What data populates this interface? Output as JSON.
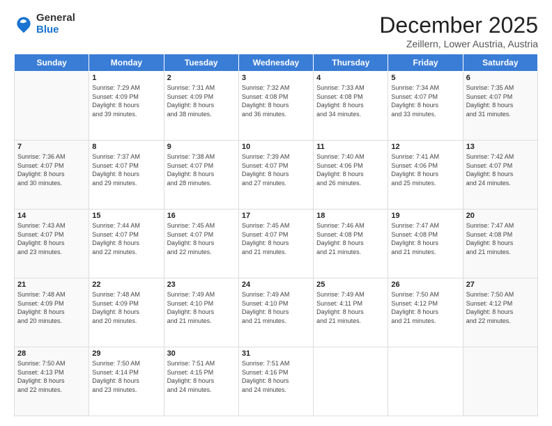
{
  "logo": {
    "general": "General",
    "blue": "Blue"
  },
  "header": {
    "month": "December 2025",
    "location": "Zeillern, Lower Austria, Austria"
  },
  "weekdays": [
    "Sunday",
    "Monday",
    "Tuesday",
    "Wednesday",
    "Thursday",
    "Friday",
    "Saturday"
  ],
  "weeks": [
    [
      {
        "day": "",
        "info": ""
      },
      {
        "day": "1",
        "info": "Sunrise: 7:29 AM\nSunset: 4:09 PM\nDaylight: 8 hours\nand 39 minutes."
      },
      {
        "day": "2",
        "info": "Sunrise: 7:31 AM\nSunset: 4:09 PM\nDaylight: 8 hours\nand 38 minutes."
      },
      {
        "day": "3",
        "info": "Sunrise: 7:32 AM\nSunset: 4:08 PM\nDaylight: 8 hours\nand 36 minutes."
      },
      {
        "day": "4",
        "info": "Sunrise: 7:33 AM\nSunset: 4:08 PM\nDaylight: 8 hours\nand 34 minutes."
      },
      {
        "day": "5",
        "info": "Sunrise: 7:34 AM\nSunset: 4:07 PM\nDaylight: 8 hours\nand 33 minutes."
      },
      {
        "day": "6",
        "info": "Sunrise: 7:35 AM\nSunset: 4:07 PM\nDaylight: 8 hours\nand 31 minutes."
      }
    ],
    [
      {
        "day": "7",
        "info": "Sunrise: 7:36 AM\nSunset: 4:07 PM\nDaylight: 8 hours\nand 30 minutes."
      },
      {
        "day": "8",
        "info": "Sunrise: 7:37 AM\nSunset: 4:07 PM\nDaylight: 8 hours\nand 29 minutes."
      },
      {
        "day": "9",
        "info": "Sunrise: 7:38 AM\nSunset: 4:07 PM\nDaylight: 8 hours\nand 28 minutes."
      },
      {
        "day": "10",
        "info": "Sunrise: 7:39 AM\nSunset: 4:07 PM\nDaylight: 8 hours\nand 27 minutes."
      },
      {
        "day": "11",
        "info": "Sunrise: 7:40 AM\nSunset: 4:06 PM\nDaylight: 8 hours\nand 26 minutes."
      },
      {
        "day": "12",
        "info": "Sunrise: 7:41 AM\nSunset: 4:06 PM\nDaylight: 8 hours\nand 25 minutes."
      },
      {
        "day": "13",
        "info": "Sunrise: 7:42 AM\nSunset: 4:07 PM\nDaylight: 8 hours\nand 24 minutes."
      }
    ],
    [
      {
        "day": "14",
        "info": "Sunrise: 7:43 AM\nSunset: 4:07 PM\nDaylight: 8 hours\nand 23 minutes."
      },
      {
        "day": "15",
        "info": "Sunrise: 7:44 AM\nSunset: 4:07 PM\nDaylight: 8 hours\nand 22 minutes."
      },
      {
        "day": "16",
        "info": "Sunrise: 7:45 AM\nSunset: 4:07 PM\nDaylight: 8 hours\nand 22 minutes."
      },
      {
        "day": "17",
        "info": "Sunrise: 7:45 AM\nSunset: 4:07 PM\nDaylight: 8 hours\nand 21 minutes."
      },
      {
        "day": "18",
        "info": "Sunrise: 7:46 AM\nSunset: 4:08 PM\nDaylight: 8 hours\nand 21 minutes."
      },
      {
        "day": "19",
        "info": "Sunrise: 7:47 AM\nSunset: 4:08 PM\nDaylight: 8 hours\nand 21 minutes."
      },
      {
        "day": "20",
        "info": "Sunrise: 7:47 AM\nSunset: 4:08 PM\nDaylight: 8 hours\nand 21 minutes."
      }
    ],
    [
      {
        "day": "21",
        "info": "Sunrise: 7:48 AM\nSunset: 4:09 PM\nDaylight: 8 hours\nand 20 minutes."
      },
      {
        "day": "22",
        "info": "Sunrise: 7:48 AM\nSunset: 4:09 PM\nDaylight: 8 hours\nand 20 minutes."
      },
      {
        "day": "23",
        "info": "Sunrise: 7:49 AM\nSunset: 4:10 PM\nDaylight: 8 hours\nand 21 minutes."
      },
      {
        "day": "24",
        "info": "Sunrise: 7:49 AM\nSunset: 4:10 PM\nDaylight: 8 hours\nand 21 minutes."
      },
      {
        "day": "25",
        "info": "Sunrise: 7:49 AM\nSunset: 4:11 PM\nDaylight: 8 hours\nand 21 minutes."
      },
      {
        "day": "26",
        "info": "Sunrise: 7:50 AM\nSunset: 4:12 PM\nDaylight: 8 hours\nand 21 minutes."
      },
      {
        "day": "27",
        "info": "Sunrise: 7:50 AM\nSunset: 4:12 PM\nDaylight: 8 hours\nand 22 minutes."
      }
    ],
    [
      {
        "day": "28",
        "info": "Sunrise: 7:50 AM\nSunset: 4:13 PM\nDaylight: 8 hours\nand 22 minutes."
      },
      {
        "day": "29",
        "info": "Sunrise: 7:50 AM\nSunset: 4:14 PM\nDaylight: 8 hours\nand 23 minutes."
      },
      {
        "day": "30",
        "info": "Sunrise: 7:51 AM\nSunset: 4:15 PM\nDaylight: 8 hours\nand 24 minutes."
      },
      {
        "day": "31",
        "info": "Sunrise: 7:51 AM\nSunset: 4:16 PM\nDaylight: 8 hours\nand 24 minutes."
      },
      {
        "day": "",
        "info": ""
      },
      {
        "day": "",
        "info": ""
      },
      {
        "day": "",
        "info": ""
      }
    ]
  ]
}
